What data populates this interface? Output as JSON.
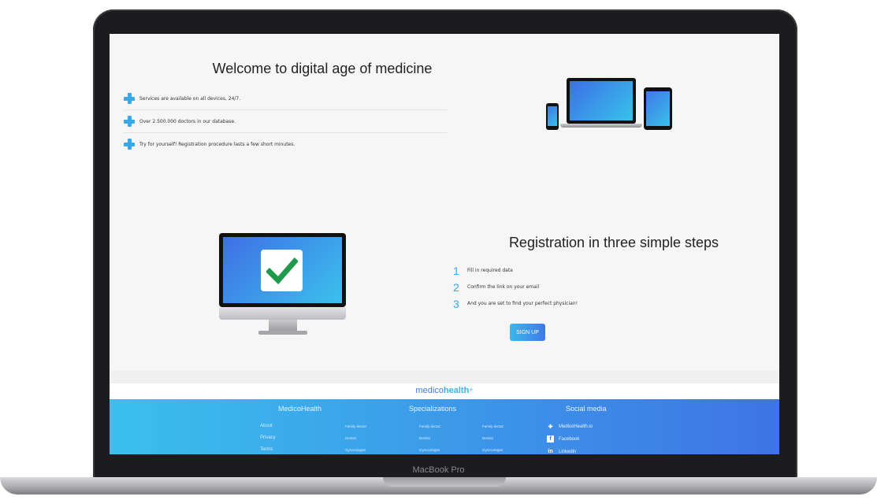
{
  "welcome": {
    "title": "Welcome to digital age of medicine",
    "features": [
      "Services are available on all devices, 24/7.",
      "Over 2.500.000 doctors in our database.",
      "Try for yourself! Registration procedure lasts a few short minutes."
    ]
  },
  "registration": {
    "title": "Registration in three simple steps",
    "steps": [
      {
        "num": "1",
        "text": "Fill in required data"
      },
      {
        "num": "2",
        "text": "Confirm the link on your email"
      },
      {
        "num": "3",
        "text": "And you are set to find your perfect physician!"
      }
    ],
    "signup_label": "SIGN UP"
  },
  "brand": {
    "part1": "medico",
    "part2": "health",
    "mark": "+"
  },
  "footer": {
    "col1_title": "MedicoHealth",
    "col2_title": "Specializations",
    "col3_title": "Social media",
    "col1_links": [
      "About",
      "Privacy",
      "Terms"
    ],
    "spec_columns": [
      [
        "Family doctor",
        "Dentist",
        "Gynecologist"
      ],
      [
        "Family doctor",
        "Dentist",
        "Gynecologist"
      ],
      [
        "Family doctor",
        "Dentist",
        "Gynecologist"
      ]
    ],
    "social": [
      "MedicoHealth.io",
      "Facebook",
      "Linkedin"
    ]
  },
  "device": {
    "label": "MacBook Pro"
  },
  "colors": {
    "accent": "#39a8e6",
    "gradient_start": "#3ac0ed",
    "gradient_end": "#3e74e5"
  }
}
